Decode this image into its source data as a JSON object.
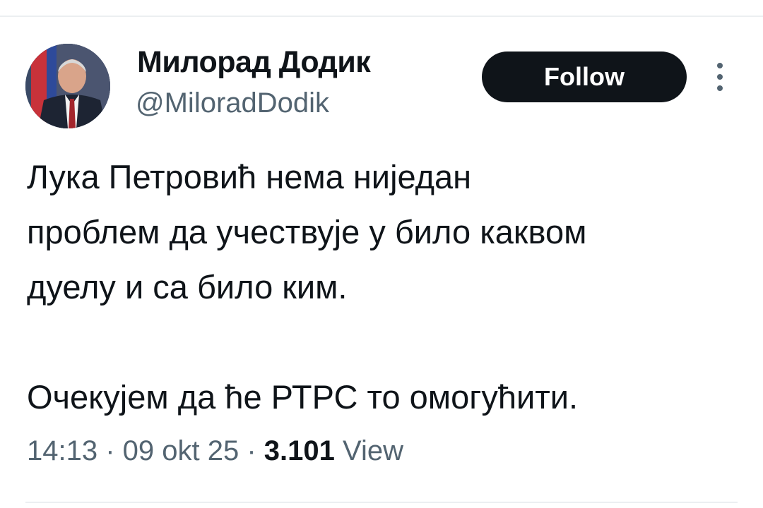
{
  "tweet": {
    "author": {
      "display_name": "Милорад Додик",
      "handle": "@MiloradDodik"
    },
    "follow_label": "Follow",
    "text_lines": [
      "Лука Петровић нема ниједан",
      "проблем да учествује у било каквом",
      "дуелу и са било ким."
    ],
    "text_line_2": "Очекујем да ће РТРС то омогућити.",
    "meta": {
      "time": "14:13",
      "separator": " · ",
      "date": "09 okt 25",
      "views_count": "3.101",
      "views_label": "View"
    }
  },
  "colors": {
    "text_primary": "#0f1419",
    "text_secondary": "#536471",
    "follow_bg": "#0f1419",
    "divider": "#eceff1"
  },
  "icons": {
    "more": "three-dots-vertical-icon"
  }
}
